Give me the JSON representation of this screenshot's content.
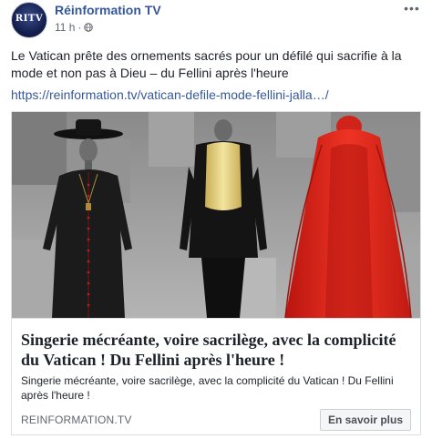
{
  "post": {
    "page_name": "Réinformation TV",
    "timestamp": "11 h",
    "separator": "·",
    "avatar_text": "RITV",
    "text": "Le Vatican prête des ornements sacrés pour un défilé qui sacrifie à la mode et non pas à Dieu – du Fellini après l'heure",
    "link": "https://reinformation.tv/vatican-defile-mode-fellini-jalla…/",
    "more_icon": "ellipsis-icon",
    "privacy_icon": "globe-icon"
  },
  "card": {
    "title": "Singerie mécréante, voire sacrilège, avec la complicité du Vatican ! Du Fellini après l'heure !",
    "description": "Singerie mécréante, voire sacrilège, avec la complicité du Vatican ! Du Fellini après l'heure !",
    "domain": "REINFORMATION.TV",
    "cta_label": "En savoir plus"
  },
  "colors": {
    "link_blue": "#365899",
    "text": "#1d2129",
    "meta_gray": "#616770",
    "border": "#dddfe2",
    "cassock_red": "#e0281e"
  }
}
